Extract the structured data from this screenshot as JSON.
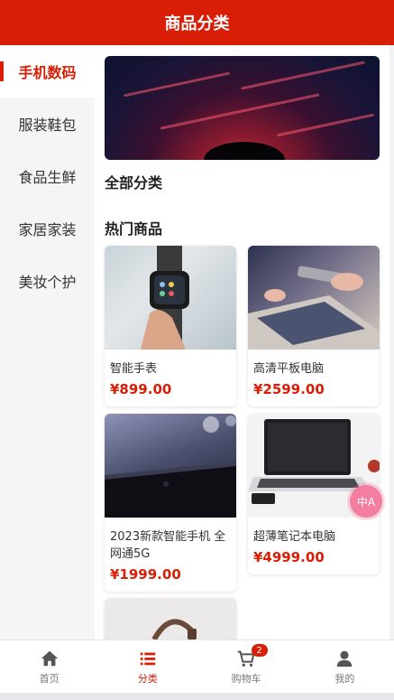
{
  "header": {
    "title": "商品分类"
  },
  "sidebar": {
    "items": [
      {
        "label": "手机数码",
        "active": true
      },
      {
        "label": "服装鞋包",
        "active": false
      },
      {
        "label": "食品生鲜",
        "active": false
      },
      {
        "label": "家居家装",
        "active": false
      },
      {
        "label": "美妆个护",
        "active": false
      }
    ]
  },
  "main": {
    "all_categories_title": "全部分类",
    "hot_products_title": "热门商品",
    "products": [
      {
        "name": "智能手表",
        "price": "¥899.00",
        "image": "smartwatch"
      },
      {
        "name": "高清平板电脑",
        "price": "¥2599.00",
        "image": "tablet"
      },
      {
        "name": "2023新款智能手机 全网通5G",
        "price": "¥1999.00",
        "image": "smartphone"
      },
      {
        "name": "超薄笔记本电脑",
        "price": "¥4999.00",
        "image": "laptop"
      },
      {
        "name": "",
        "price": "",
        "image": "bag"
      }
    ]
  },
  "float_button": {
    "label": "中A"
  },
  "tabbar": {
    "tabs": [
      {
        "label": "首页",
        "icon": "home-icon",
        "active": false
      },
      {
        "label": "分类",
        "icon": "list-icon",
        "active": true
      },
      {
        "label": "购物车",
        "icon": "cart-icon",
        "active": false,
        "badge": "2"
      },
      {
        "label": "我的",
        "icon": "user-icon",
        "active": false
      }
    ]
  },
  "colors": {
    "brand": "#d81e06",
    "text": "#333333",
    "muted": "#777777"
  }
}
